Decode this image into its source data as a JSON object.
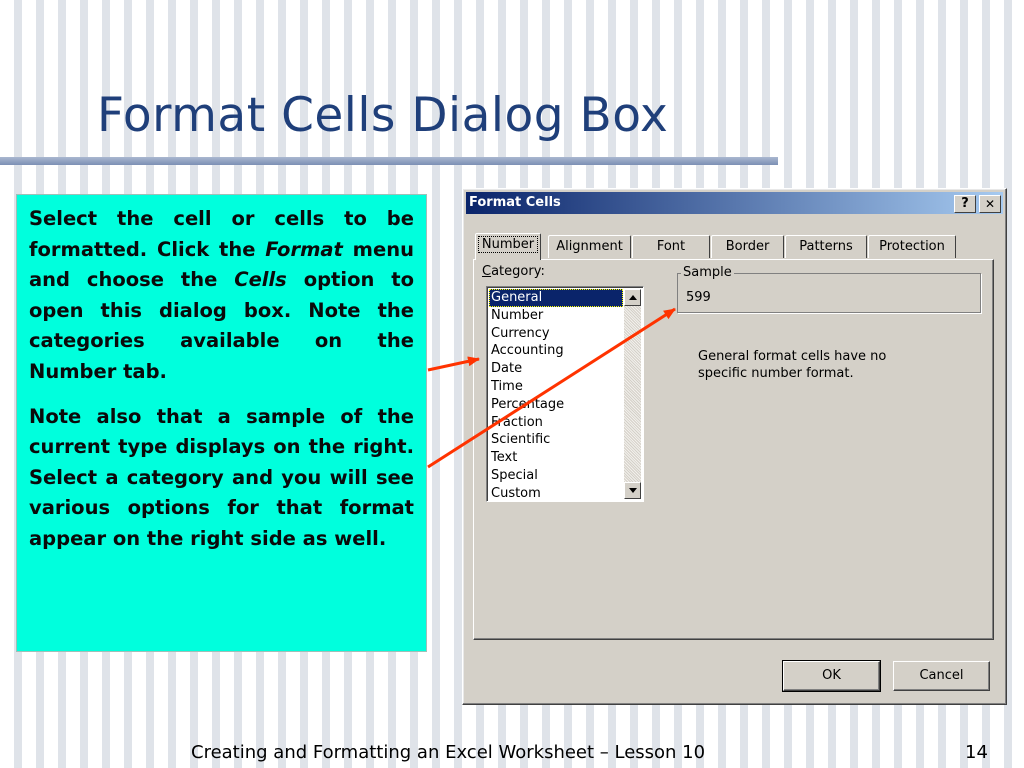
{
  "slide": {
    "title": "Format Cells Dialog Box",
    "footer_text": "Creating and Formatting an Excel Worksheet – Lesson 10",
    "page_number": "14"
  },
  "note": {
    "p1_part1": "Select the cell or cells to be formatted. Click the ",
    "p1_format": "Format",
    "p1_part2": " menu and choose the ",
    "p1_cells": "Cells",
    "p1_part3": " option to open this dialog box. Note the categories available on the Number tab.",
    "p2": "Note also that a sample of the current type displays on the right. Select a category and you will see various options for that format appear on the right side as well.",
    "background_color": "#00ffdd"
  },
  "dialog": {
    "title": "Format Cells",
    "help_label": "?",
    "close_label": "✕",
    "tabs": [
      {
        "label": "Number",
        "active": true
      },
      {
        "label": "Alignment",
        "active": false
      },
      {
        "label": "Font",
        "active": false
      },
      {
        "label": "Border",
        "active": false
      },
      {
        "label": "Patterns",
        "active": false
      },
      {
        "label": "Protection",
        "active": false
      }
    ],
    "category_label": "Category:",
    "categories": [
      "General",
      "Number",
      "Currency",
      "Accounting",
      "Date",
      "Time",
      "Percentage",
      "Fraction",
      "Scientific",
      "Text",
      "Special",
      "Custom"
    ],
    "selected_category": "General",
    "sample_label": "Sample",
    "sample_value": "599",
    "description": "General format cells have no specific number format.",
    "ok_label": "OK",
    "cancel_label": "Cancel",
    "titlebar_color": "#0a246a"
  },
  "colors": {
    "title_color": "#1f3f7a",
    "arrow_color": "#ff3300"
  }
}
